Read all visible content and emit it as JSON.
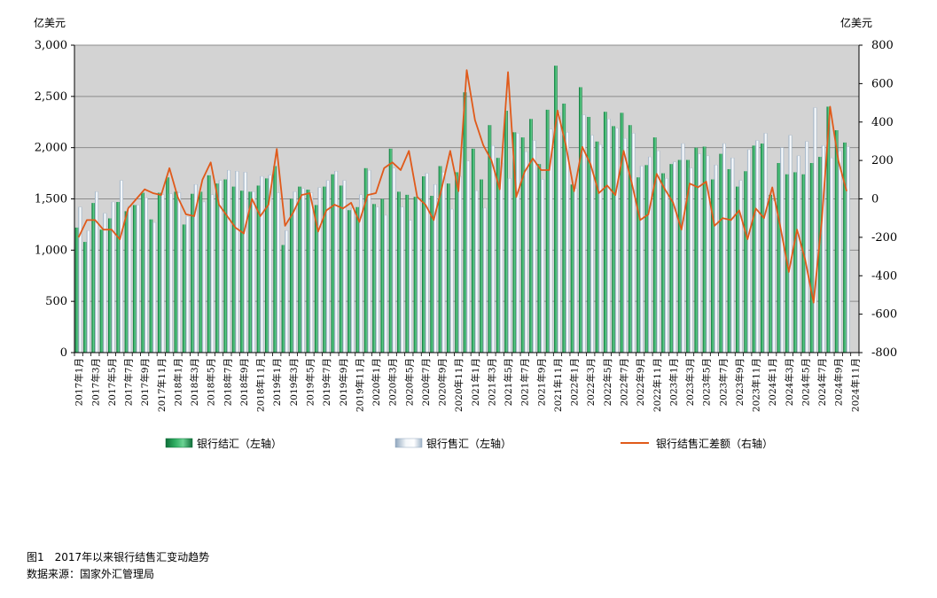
{
  "chart_data": {
    "type": "bar",
    "left_unit": "亿美元",
    "right_unit": "亿美元",
    "left_ylim": [
      0,
      3000
    ],
    "left_ticks": [
      "0",
      "500",
      "1,000",
      "1,500",
      "2,000",
      "2,500",
      "3,000"
    ],
    "right_ylim": [
      -800,
      800
    ],
    "right_ticks": [
      "-800",
      "-600",
      "-400",
      "-200",
      "0",
      "200",
      "400",
      "600",
      "800"
    ],
    "grid": true,
    "legend_position": "bottom",
    "categories": [
      "2017年1月",
      "2017年2月",
      "2017年3月",
      "2017年4月",
      "2017年5月",
      "2017年6月",
      "2017年7月",
      "2017年8月",
      "2017年9月",
      "2017年10月",
      "2017年11月",
      "2017年12月",
      "2018年1月",
      "2018年2月",
      "2018年3月",
      "2018年4月",
      "2018年5月",
      "2018年6月",
      "2018年7月",
      "2018年8月",
      "2018年9月",
      "2018年10月",
      "2018年11月",
      "2018年12月",
      "2019年1月",
      "2019年2月",
      "2019年3月",
      "2019年4月",
      "2019年5月",
      "2019年6月",
      "2019年7月",
      "2019年8月",
      "2019年9月",
      "2019年10月",
      "2019年11月",
      "2019年12月",
      "2020年1月",
      "2020年2月",
      "2020年3月",
      "2020年4月",
      "2020年5月",
      "2020年6月",
      "2020年7月",
      "2020年8月",
      "2020年9月",
      "2020年10月",
      "2020年11月",
      "2020年12月",
      "2021年1月",
      "2021年2月",
      "2021年3月",
      "2021年4月",
      "2021年5月",
      "2021年6月",
      "2021年7月",
      "2021年8月",
      "2021年9月",
      "2021年10月",
      "2021年11月",
      "2021年12月",
      "2022年1月",
      "2022年2月",
      "2022年3月",
      "2022年4月",
      "2022年5月",
      "2022年6月",
      "2022年7月",
      "2022年8月",
      "2022年9月",
      "2022年10月",
      "2022年11月",
      "2022年12月",
      "2023年1月",
      "2023年2月",
      "2023年3月",
      "2023年4月",
      "2023年5月",
      "2023年6月",
      "2023年7月",
      "2023年8月",
      "2023年9月",
      "2023年10月",
      "2023年11月",
      "2023年12月",
      "2024年1月",
      "2024年2月",
      "2024年3月",
      "2024年4月",
      "2024年5月",
      "2024年6月",
      "2024年7月",
      "2024年8月",
      "2024年9月",
      "2024年10月",
      "2024年11月"
    ],
    "series": [
      {
        "name": "银行结汇（左轴）",
        "axis": "left",
        "color": "#1a9450",
        "values": [
          1220,
          1080,
          1460,
          1200,
          1310,
          1470,
          1380,
          1440,
          1560,
          1300,
          1560,
          1710,
          1570,
          1250,
          1550,
          1570,
          1730,
          1650,
          1690,
          1620,
          1580,
          1570,
          1630,
          1700,
          1820,
          1050,
          1500,
          1620,
          1590,
          1440,
          1620,
          1740,
          1630,
          1390,
          1420,
          1800,
          1450,
          1500,
          1990,
          1570,
          1540,
          1520,
          1720,
          1530,
          1820,
          1650,
          1760,
          2540,
          1990,
          1690,
          2220,
          1900,
          2360,
          2150,
          2100,
          2280,
          1840,
          2370,
          2800,
          2430,
          1640,
          2590,
          2300,
          2060,
          2350,
          2210,
          2340,
          2220,
          1710,
          1830,
          2100,
          1750,
          1840,
          1880,
          1880,
          2000,
          2010,
          1690,
          1940,
          1790,
          1620,
          1770,
          2020,
          2040,
          1540,
          1850,
          1740,
          1760,
          1740,
          1850,
          1910,
          2400,
          2170,
          2050
        ]
      },
      {
        "name": "银行售汇（左轴）",
        "axis": "left",
        "color": "#c6d4e0",
        "values": [
          1420,
          1190,
          1570,
          1360,
          1470,
          1680,
          1430,
          1440,
          1510,
          1270,
          1540,
          1550,
          1560,
          1330,
          1640,
          1470,
          1540,
          1680,
          1780,
          1770,
          1760,
          1570,
          1720,
          1730,
          1560,
          1190,
          1570,
          1600,
          1560,
          1610,
          1680,
          1770,
          1680,
          1410,
          1540,
          1780,
          1420,
          1340,
          1800,
          1420,
          1290,
          1510,
          1750,
          1640,
          1760,
          1400,
          1720,
          1870,
          1580,
          1410,
          2020,
          1850,
          1700,
          2140,
          1960,
          2070,
          1690,
          2180,
          2340,
          2150,
          1600,
          2320,
          2120,
          2030,
          2280,
          2190,
          2090,
          2140,
          1820,
          1910,
          1970,
          1700,
          1860,
          2040,
          1800,
          1940,
          1920,
          1830,
          2040,
          1900,
          1680,
          1980,
          2070,
          2140,
          1480,
          2000,
          2120,
          1920,
          2060,
          2390,
          2020,
          1900,
          1970,
          2010
        ]
      },
      {
        "name": "银行结售汇差额（右轴）",
        "axis": "right",
        "type": "line",
        "color": "#e05a1a",
        "values": [
          -200,
          -110,
          -110,
          -160,
          -160,
          -210,
          -50,
          0,
          50,
          30,
          20,
          160,
          10,
          -80,
          -90,
          100,
          190,
          -30,
          -90,
          -150,
          -180,
          0,
          -90,
          -30,
          260,
          -140,
          -70,
          20,
          30,
          -170,
          -60,
          -30,
          -50,
          -20,
          -120,
          20,
          30,
          160,
          190,
          150,
          250,
          10,
          -30,
          -110,
          60,
          250,
          40,
          670,
          410,
          280,
          200,
          50,
          660,
          10,
          140,
          210,
          150,
          150,
          460,
          280,
          40,
          270,
          180,
          30,
          70,
          20,
          250,
          80,
          -110,
          -80,
          130,
          50,
          -20,
          -160,
          80,
          60,
          90,
          -140,
          -100,
          -110,
          -60,
          -210,
          -50,
          -100,
          60,
          -150,
          -380,
          -160,
          -320,
          -540,
          -110,
          480,
          200,
          40
        ]
      }
    ]
  },
  "footer": {
    "caption": "图1　2017年以来银行结售汇变动趋势",
    "source": "数据来源：国家外汇管理局"
  }
}
